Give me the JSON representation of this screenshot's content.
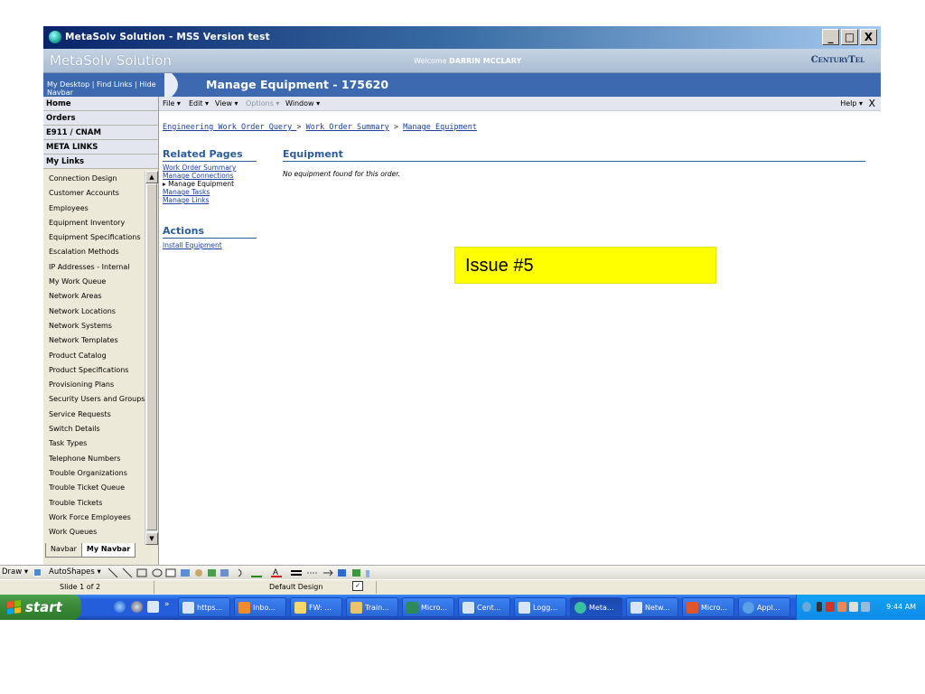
{
  "window": {
    "title": "MetaSolv Solution - MSS Version test",
    "controls": [
      "_",
      "□",
      "X"
    ]
  },
  "brand": {
    "product": "MetaSolv Solution",
    "welcome_prefix": "Welcome",
    "user": "DARRIN MCCLARY",
    "logo": "CenturyTel"
  },
  "navbar": {
    "my_desktop": "My Desktop",
    "find_links": "Find Links",
    "hide_navbar": "Hide Navbar",
    "sep": "|",
    "page_title": "Manage Equipment  - 175620"
  },
  "sidebar": {
    "headers": [
      "Home",
      "Orders",
      "E911 / CNAM",
      "META LINKS",
      "My Links"
    ],
    "my_links": [
      "Connection Design",
      "Customer Accounts",
      "Employees",
      "Equipment Inventory",
      "Equipment Specifications",
      "Escalation Methods",
      "IP Addresses - Internal",
      "My Work Queue",
      "Network Areas",
      "Network Locations",
      "Network Systems",
      "Network Templates",
      "Product Catalog",
      "Product Specifications",
      "Provisioning Plans",
      "Security Users and Groups",
      "Service Requests",
      "Switch Details",
      "Task Types",
      "Telephone Numbers",
      "Trouble Organizations",
      "Trouble Ticket Queue",
      "Trouble Tickets",
      "Work Force Employees",
      "Work Queues"
    ],
    "tabs": [
      "Navbar",
      "My Navbar"
    ]
  },
  "menubar": {
    "items": [
      {
        "label": "File ▾",
        "disabled": false
      },
      {
        "label": "Edit ▾",
        "disabled": false
      },
      {
        "label": "View ▾",
        "disabled": false
      },
      {
        "label": "Options ▾",
        "disabled": true
      },
      {
        "label": "Window ▾",
        "disabled": false
      }
    ],
    "help": "Help ▾",
    "close": "X"
  },
  "breadcrumb": {
    "items": [
      "Engineering Work Order Query ",
      "Work Order Summary",
      "Manage Equipment"
    ],
    "separator": ">"
  },
  "related_pages": {
    "title": "Related Pages",
    "links": [
      {
        "label": "Work Order Summary",
        "current": false
      },
      {
        "label": "Manage Connections",
        "current": false
      },
      {
        "label": "▸ Manage Equipment",
        "current": true
      },
      {
        "label": "Manage Tasks",
        "current": false
      },
      {
        "label": "Manage Links",
        "current": false
      }
    ]
  },
  "actions": {
    "title": "Actions",
    "links": [
      "Install Equipment"
    ]
  },
  "equipment": {
    "title": "Equipment",
    "empty_message": "No equipment found for this order."
  },
  "issue_callout": {
    "text": "Issue #5",
    "color": "#ffff00"
  },
  "draw_toolbar": {
    "draw": "Draw ▾",
    "autoshapes": "AutoShapes ▾"
  },
  "statusbar": {
    "slide": "Slide 1 of 2",
    "design": "Default Design"
  },
  "taskbar": {
    "start": "start",
    "tasks": [
      {
        "label": "https...",
        "color": "#d8e4f8"
      },
      {
        "label": "Inbo...",
        "color": "#f28b2e"
      },
      {
        "label": "FW: ...",
        "color": "#f5d76e"
      },
      {
        "label": "Train...",
        "color": "#e9c46a"
      },
      {
        "label": "Micro...",
        "color": "#2e8b57"
      },
      {
        "label": "Cent...",
        "color": "#d8e4f8"
      },
      {
        "label": "Logg...",
        "color": "#d8e4f8"
      },
      {
        "label": "Meta...",
        "color": "#3bbfa3"
      },
      {
        "label": "Netw...",
        "color": "#d8e4f8"
      },
      {
        "label": "Micro...",
        "color": "#e0562c"
      },
      {
        "label": "Appl...",
        "color": "#5aa0e6"
      }
    ],
    "clock": "9:44 AM"
  }
}
